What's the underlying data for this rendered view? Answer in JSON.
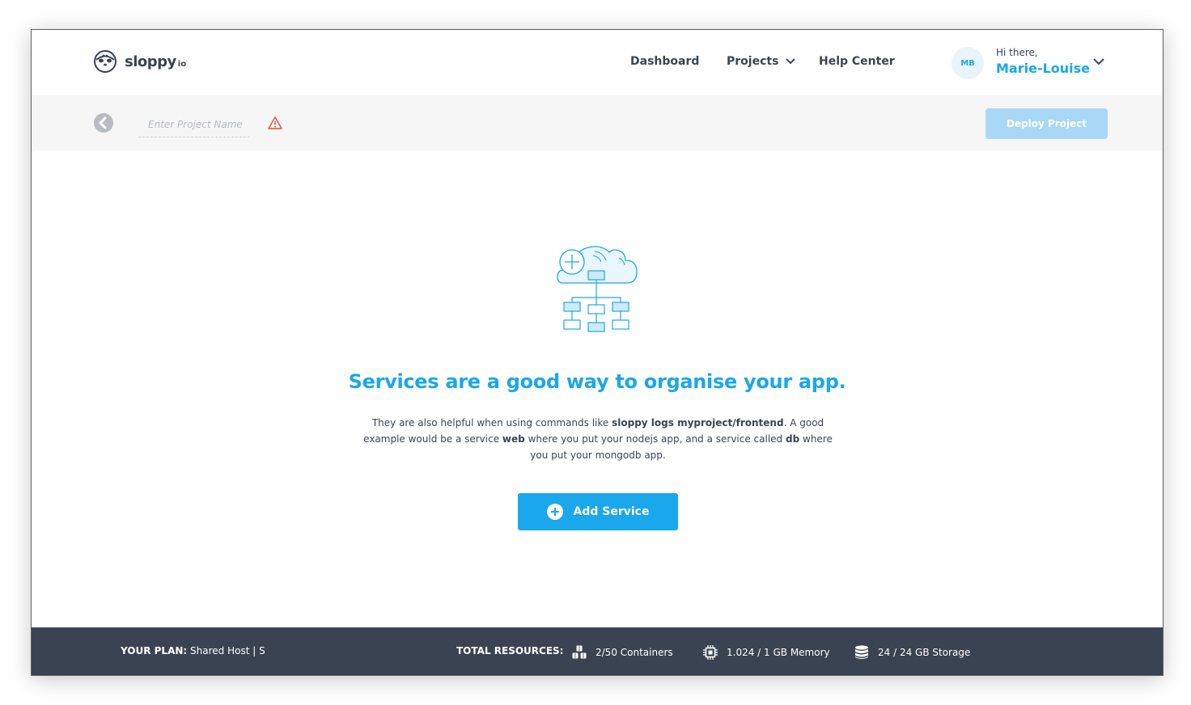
{
  "brand": {
    "name": "sloppy",
    "suffix": "io"
  },
  "nav": {
    "dashboard": "Dashboard",
    "projects": "Projects",
    "help": "Help Center"
  },
  "user": {
    "initials": "MB",
    "greeting": "Hi there,",
    "name": "Marie-Louise"
  },
  "toolbar": {
    "project_name_placeholder": "Enter Project Name",
    "project_name_value": "",
    "deploy_label": "Deploy Project"
  },
  "main": {
    "headline": "Services are a good way to organise your app.",
    "description": {
      "p1": "They are also helpful when using commands like ",
      "b1": "sloppy logs myproject/frontend",
      "p2": ". A good example would be a service ",
      "b2": "web",
      "p3": " where you put your nodejs app, and a service called ",
      "b3": "db",
      "p4": " where you put your mongodb app."
    },
    "add_service_label": "Add Service"
  },
  "footer": {
    "plan_label": "YOUR PLAN:",
    "plan_value": "Shared Host | S",
    "resources_label": "TOTAL RESOURCES:",
    "containers": "2/50 Containers",
    "memory": "1.024 / 1 GB Memory",
    "storage": "24 / 24 GB Storage"
  },
  "colors": {
    "accent": "#1aa7ec",
    "deploy_disabled": "#a8d8f5",
    "footer_bg": "#3a4352",
    "toolbar_bg": "#f6f6f6",
    "warning": "#e04b3c"
  },
  "icons": {
    "logo": "sloth-face-icon",
    "projects_dropdown": "chevron-down-icon",
    "user_menu": "chevron-down-icon",
    "back": "back-arrow-icon",
    "warning": "warning-triangle-icon",
    "illustration": "cloud-services-icon",
    "add": "plus-circle-icon",
    "containers": "cubes-icon",
    "memory": "chip-icon",
    "storage": "database-icon"
  }
}
